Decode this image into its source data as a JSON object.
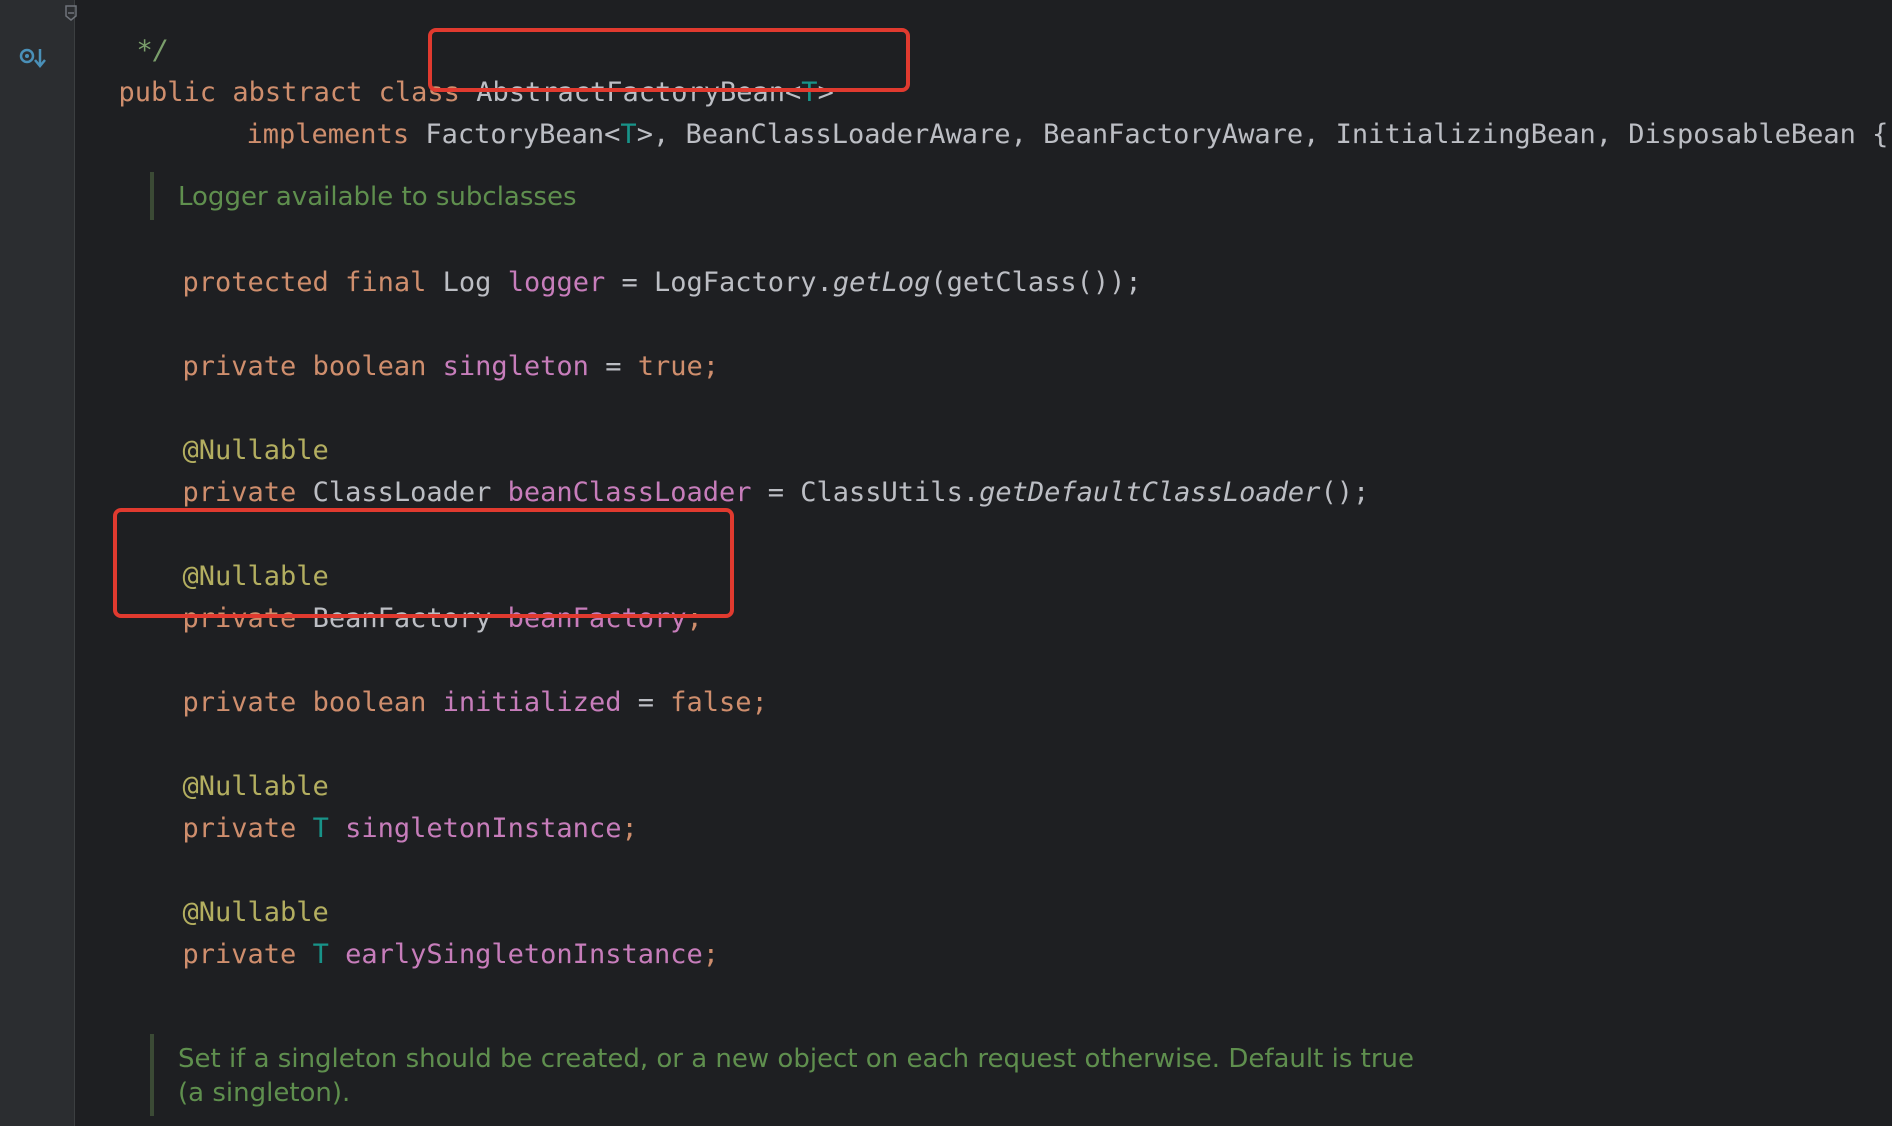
{
  "code": {
    "comment_end": "*/",
    "class_decl": {
      "kw_public": "public",
      "kw_abstract": "abstract",
      "kw_class": "class",
      "class_name": "AbstractFactoryBean<",
      "type_param": "T",
      "close": ">"
    },
    "implements_line": {
      "kw_implements": "implements",
      "iface1": "FactoryBean<",
      "iface1_param": "T",
      "iface1_close": ">,",
      "rest": " BeanClassLoaderAware, BeanFactoryAware, InitializingBean, DisposableBean {"
    },
    "doc_logger": "Logger available to subclasses",
    "logger_line": {
      "kw_protected": "protected",
      "kw_final": "final",
      "type": "Log",
      "field": "logger",
      "eq": " = LogFactory.",
      "method": "getLog",
      "tail": "(getClass());"
    },
    "singleton_line": {
      "kw_private": "private",
      "kw_boolean": "boolean",
      "field": "singleton",
      "eq": " = ",
      "value": "true",
      "semi": ";"
    },
    "annotation": "@Nullable",
    "classloader_line": {
      "kw_private": "private",
      "type": "ClassLoader",
      "field": "beanClassLoader",
      "eq": " = ClassUtils.",
      "method": "getDefaultClassLoader",
      "tail": "();"
    },
    "beanfactory_line": {
      "kw_private": "private",
      "type": "BeanFactory",
      "field": "beanFactory",
      "semi": ";"
    },
    "initialized_line": {
      "kw_private": "private",
      "kw_boolean": "boolean",
      "field": "initialized",
      "eq": " = ",
      "value": "false",
      "semi": ";"
    },
    "singleton_instance_line": {
      "kw_private": "private",
      "type": "T",
      "field": "singletonInstance",
      "semi": ";"
    },
    "early_singleton_line": {
      "kw_private": "private",
      "type": "T",
      "field": "earlySingletonInstance",
      "semi": ";"
    },
    "doc_singleton_line1": "Set if a singleton should be created, or a new object on each request otherwise. Default is true",
    "doc_singleton_line2": "(a singleton)."
  },
  "colors": {
    "background": "#1e1f22",
    "keyword": "#cf8e6d",
    "field": "#c77dbb",
    "annotation": "#b3ae60",
    "doc_comment": "#5f8f4e",
    "highlight_box": "#e03a2f"
  }
}
